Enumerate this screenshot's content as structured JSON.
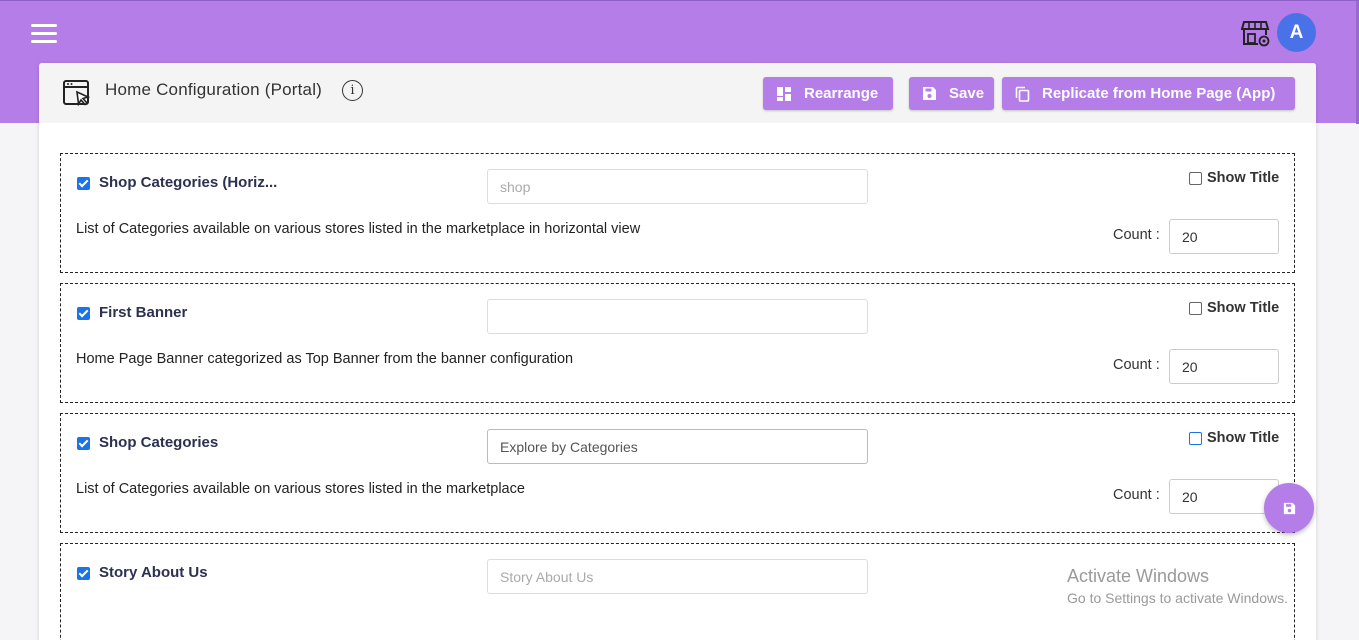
{
  "header": {
    "title": "Home Configuration (Portal)",
    "info_glyph": "i",
    "avatar_letter": "A",
    "buttons": {
      "rearrange": "Rearrange",
      "save": "Save",
      "replicate": "Replicate from Home Page (App)"
    }
  },
  "colors": {
    "brand": "#b57de8",
    "avatar": "#4a72e8",
    "checkbox": "#1a73e8",
    "section_title": "#2c3150"
  },
  "icons": [
    "menu-icon",
    "store-settings-icon",
    "page-cursor-icon",
    "info-icon",
    "grid-icon",
    "save-icon",
    "copy-icon",
    "checkbox-icon"
  ],
  "sections": [
    {
      "enabled": true,
      "title": "Shop Categories (Horiz...",
      "title_input_value": "",
      "title_input_placeholder": "shop",
      "description": "List of Categories available on various stores listed in the marketplace in horizontal view",
      "show_title_label": "Show Title",
      "show_title": false,
      "count_label": "Count :",
      "count": "20"
    },
    {
      "enabled": true,
      "title": "First Banner",
      "title_input_value": "",
      "title_input_placeholder": "",
      "description": "Home Page Banner categorized as Top Banner from the banner configuration",
      "show_title_label": "Show Title",
      "show_title": false,
      "count_label": "Count :",
      "count": "20"
    },
    {
      "enabled": true,
      "title": "Shop Categories",
      "title_input_value": "Explore by Categories",
      "title_input_placeholder": "",
      "description": "List of Categories available on various stores listed in the marketplace",
      "show_title_label": "Show Title",
      "show_title": true,
      "count_label": "Count :",
      "count": "20"
    },
    {
      "enabled": true,
      "title": "Story About Us",
      "title_input_value": "",
      "title_input_placeholder": "Story About Us"
    }
  ],
  "watermark": {
    "line1": "Activate Windows",
    "line2": "Go to Settings to activate Windows."
  }
}
